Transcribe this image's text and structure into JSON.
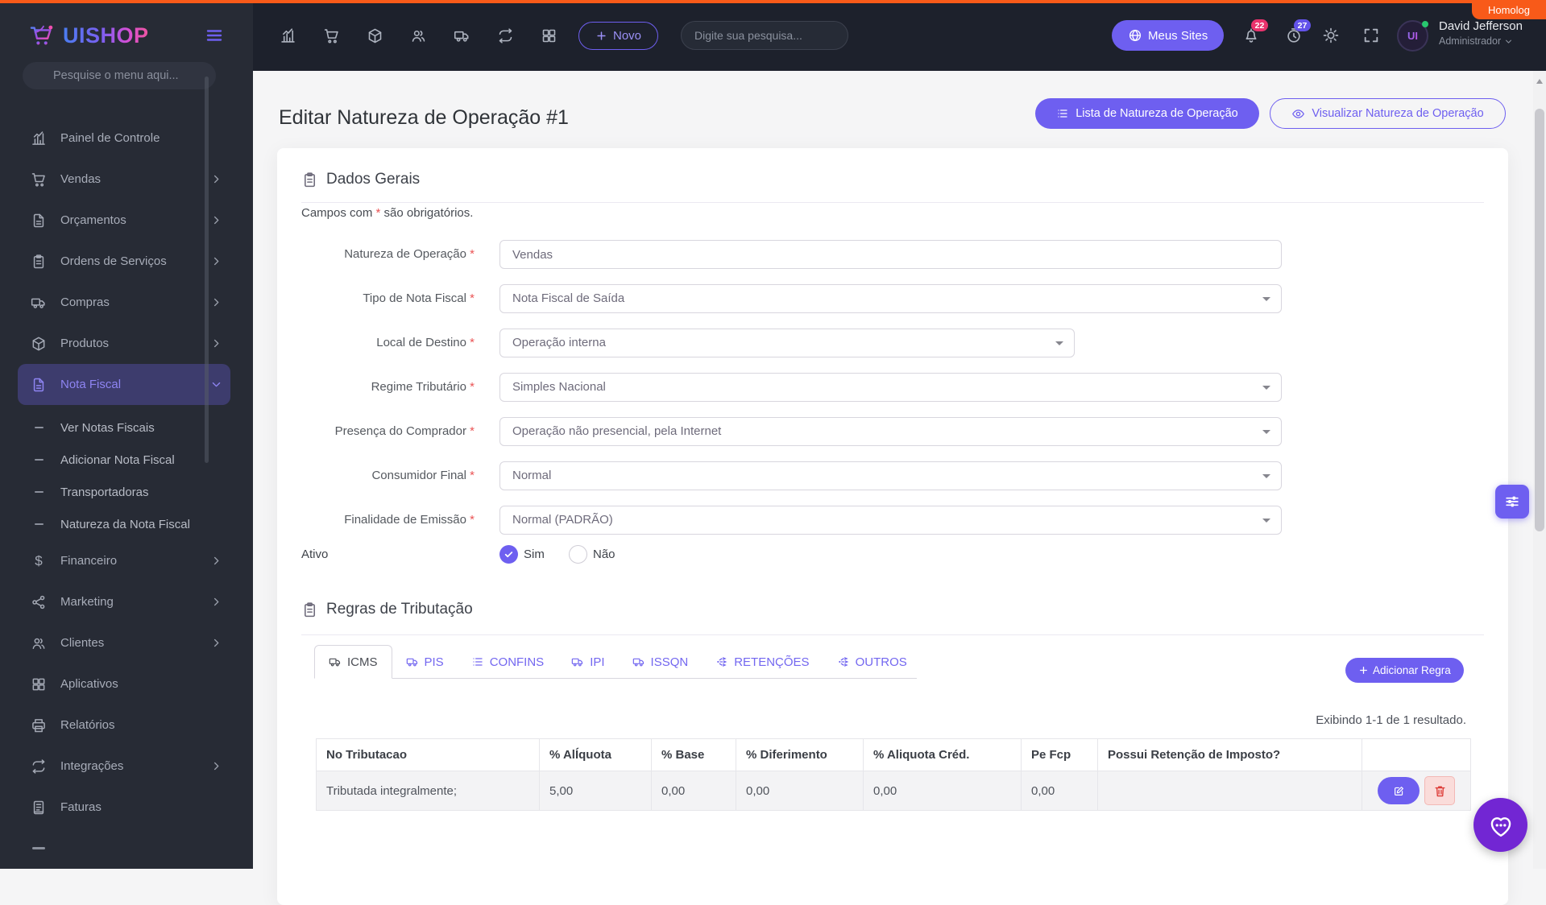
{
  "env": {
    "badge": "Homolog"
  },
  "brand": {
    "name": "UISHOP"
  },
  "sidebar": {
    "search_placeholder": "Pesquise o menu aqui...",
    "items": [
      {
        "label": "Painel de Controle",
        "icon": "chart-icon"
      },
      {
        "label": "Vendas",
        "icon": "cart-icon"
      },
      {
        "label": "Orçamentos",
        "icon": "file-icon"
      },
      {
        "label": "Ordens de Serviços",
        "icon": "clipboard-icon"
      },
      {
        "label": "Compras",
        "icon": "truck-icon"
      },
      {
        "label": "Produtos",
        "icon": "box-icon"
      },
      {
        "label": "Nota Fiscal",
        "icon": "file-icon",
        "active": true
      },
      {
        "label": "Ver Notas Fiscais",
        "sub": true
      },
      {
        "label": "Adicionar Nota Fiscal",
        "sub": true
      },
      {
        "label": "Transportadoras",
        "sub": true
      },
      {
        "label": "Natureza da Nota Fiscal",
        "sub": true
      },
      {
        "label": "Financeiro",
        "icon": "dollar-icon"
      },
      {
        "label": "Marketing",
        "icon": "share-icon"
      },
      {
        "label": "Clientes",
        "icon": "users-icon"
      },
      {
        "label": "Aplicativos",
        "icon": "grid-icon"
      },
      {
        "label": "Relatórios",
        "icon": "printer-icon"
      },
      {
        "label": "Integrações",
        "icon": "repeat-icon"
      },
      {
        "label": "Faturas",
        "icon": "filetext-icon"
      }
    ]
  },
  "navbar": {
    "new_label": "Novo",
    "search_placeholder": "Digite sua pesquisa...",
    "sites_label": "Meus Sites",
    "bell_count": "22",
    "clock_count": "27",
    "user_name": "David Jefferson",
    "user_role": "Administrador"
  },
  "page": {
    "title": "Editar Natureza de Operação #1",
    "list_button": "Lista de Natureza de Operação",
    "view_button": "Visualizar Natureza de Operação"
  },
  "general": {
    "section_title": "Dados Gerais",
    "note_prefix": "Campos com ",
    "required_mark": "*",
    "note_suffix": " são obrigatórios.",
    "fields": [
      {
        "label": "Natureza de Operação",
        "value": "Vendas",
        "control": "input"
      },
      {
        "label": "Tipo de Nota Fiscal",
        "value": "Nota Fiscal de Saída",
        "control": "select"
      },
      {
        "label": "Local de Destino",
        "value": "Operação interna",
        "control": "select"
      },
      {
        "label": "Regime Tributário",
        "value": "Simples Nacional",
        "control": "select"
      },
      {
        "label": "Presença do Comprador",
        "value": "Operação não presencial, pela Internet",
        "control": "select"
      },
      {
        "label": "Consumidor Final",
        "value": "Normal",
        "control": "select"
      },
      {
        "label": "Finalidade de Emissão",
        "value": "Normal (PADRÃO)",
        "control": "select"
      }
    ],
    "active_label": "Ativo",
    "active_yes": "Sim",
    "active_no": "Não"
  },
  "rules": {
    "section_title": "Regras de Tributação",
    "tabs": [
      {
        "label": "ICMS",
        "icon": "truck-icon",
        "active": true
      },
      {
        "label": "PIS",
        "icon": "truck-icon"
      },
      {
        "label": "CONFINS",
        "icon": "list-icon"
      },
      {
        "label": "IPI",
        "icon": "truck-icon"
      },
      {
        "label": "ISSQN",
        "icon": "truck-icon"
      },
      {
        "label": "RETENÇÕES",
        "icon": "share-nodes-icon"
      },
      {
        "label": "OUTROS",
        "icon": "share-nodes-icon"
      }
    ],
    "add_button": "Adicionar Regra",
    "results_text": "Exibindo 1-1 de 1 resultado.",
    "table": {
      "headers": [
        "No Tributacao",
        "% AlÍquota",
        "% Base",
        "% Diferimento",
        "% Aliquota Créd.",
        "Pe Fcp",
        "Possui Retenção de Imposto?"
      ],
      "row": [
        "Tributada integralmente;",
        "5,00",
        "0,00",
        "0,00",
        "0,00",
        "0,00",
        ""
      ]
    }
  },
  "colors": {
    "accent": "#6e5ff0",
    "danger": "#ea5455",
    "env_orange": "#f85a19",
    "badge_pink": "#e9336d",
    "badge_indigo": "#6353ea",
    "chat_purple": "#7226d3",
    "sidebar_bg": "#272b35",
    "navbar_bg": "#1d212c"
  }
}
